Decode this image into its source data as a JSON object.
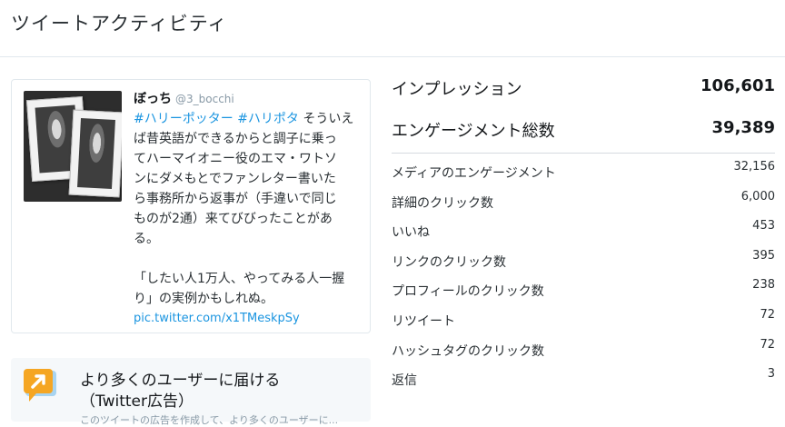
{
  "header": {
    "title": "ツイートアクティビティ"
  },
  "tweet": {
    "author_name": "ぼっち",
    "author_handle": "@3_bocchi",
    "hashtag1": "#ハリーポッター",
    "hashtag2": "#ハリポタ",
    "lines": [
      " そういえ",
      "ば昔英語ができるからと調子に乗っ",
      "てハーマイオニー役のエマ・ワトソ",
      "ンにダメもとでファンレター書いた",
      "ら事務所から返事が（手違いで同じ",
      "ものが2通）来てびびったことがあ",
      "る。"
    ],
    "lines2": [
      "「したい人1万人、やってみる人一握",
      "り」の実例かもしれぬ。"
    ],
    "link": "pic.twitter.com/x1TMeskpSy"
  },
  "promo": {
    "title_line1": "より多くのユーザーに届ける",
    "title_line2": "（Twitter広告）",
    "description": "このツイートの広告を作成して、より多くのユーザーに..."
  },
  "metrics": {
    "main": [
      {
        "label": "インプレッション",
        "value": "106,601"
      },
      {
        "label": "エンゲージメント総数",
        "value": "39,389"
      }
    ],
    "sub": [
      {
        "label": "メディアのエンゲージメント",
        "value": "32,156"
      },
      {
        "label": "詳細のクリック数",
        "value": "6,000"
      },
      {
        "label": "いいね",
        "value": "453"
      },
      {
        "label": "リンクのクリック数",
        "value": "395"
      },
      {
        "label": "プロフィールのクリック数",
        "value": "238"
      },
      {
        "label": "リツイート",
        "value": "72"
      },
      {
        "label": "ハッシュタグのクリック数",
        "value": "72"
      },
      {
        "label": "返信",
        "value": "3"
      }
    ]
  },
  "colors": {
    "link": "#1b95e0",
    "promo_icon": "#f5a623",
    "promo_bg": "#f5f8fa"
  },
  "icons": {
    "promo": "speech-bubble-arrow-icon"
  }
}
